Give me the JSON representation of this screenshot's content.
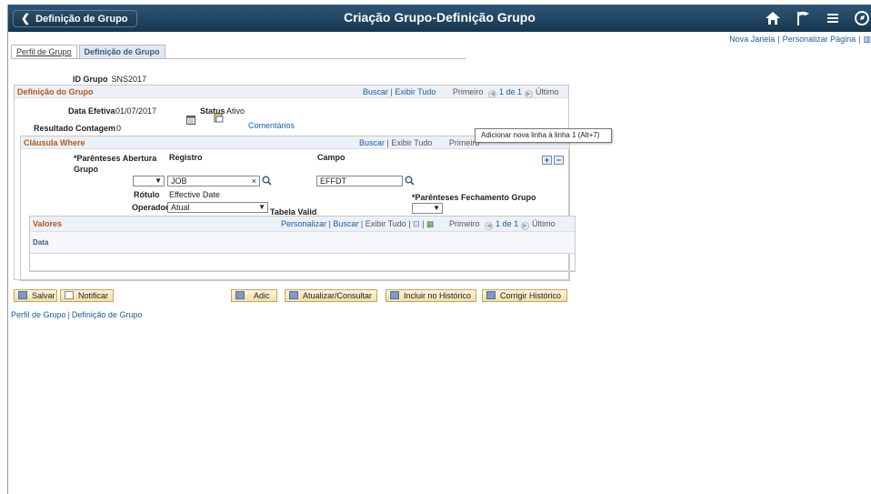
{
  "header": {
    "back_label": "Definição de Grupo",
    "title": "Criação Grupo-Definição Grupo",
    "icons": [
      "home-icon",
      "flag-icon",
      "menu-icon",
      "compass-icon"
    ]
  },
  "toplinks": {
    "new_window": "Nova Janela",
    "personalize": "Personalizar Página"
  },
  "tabs": [
    {
      "label": "Perfil de Grupo"
    },
    {
      "label": "Definição de Grupo"
    }
  ],
  "id_grupo": {
    "label": "ID Grupo",
    "value": "SNS2017"
  },
  "definicao": {
    "title": "Definição do Grupo",
    "buscar": "Buscar",
    "exibir": "Exibir Tudo",
    "primeiro": "Primeiro",
    "range": "1 de 1",
    "ultimo": "Último",
    "data_label": "Data Efetiva",
    "data_value": "01/07/2017",
    "status_label": "Status",
    "status_value": "Ativo",
    "contagem_label": "Resultado Contagem",
    "contagem_value": "0",
    "comentarios": "Comentários"
  },
  "clausula": {
    "title": "Cláusula Where",
    "buscar": "Buscar",
    "exibir": "Exibir Tudo",
    "primeiro": "Primeiro",
    "tooltip": "Adicionar nova linha à linha 1 (Alt+7)",
    "par_abertura_label": "*Parênteses Abertura Grupo",
    "registro_label": "Registro",
    "campo_label": "Campo",
    "registro_value": "JOB",
    "campo_value": "EFFDT",
    "rotulo_label": "Rótulo",
    "rotulo_value": "Effective Date",
    "par_fechamento_label": "*Parênteses Fechamento Grupo",
    "operador_label": "Operador",
    "operador_value": "Atual",
    "tabela_valid": "Tabela Valid"
  },
  "valores": {
    "title": "Valores",
    "personalizar": "Personalizar",
    "buscar": "Buscar",
    "exibir": "Exibir Tudo",
    "primeiro": "Primeiro",
    "range": "1 de 1",
    "ultimo": "Último",
    "col_data": "Data"
  },
  "toolbar": {
    "salvar": "Salvar",
    "notificar": "Notificar",
    "adic": "Adic",
    "atualizar": "Atualizar/Consultar",
    "incluir": "Incluir no Histórico",
    "corrigir": "Corrigir Histórico"
  },
  "footer": {
    "link1": "Perfil de Grupo",
    "link2": "Definição de Grupo"
  },
  "colors": {
    "header_bg": "#1f4260",
    "section_title": "#b4571c",
    "link": "#1a5ca8"
  }
}
